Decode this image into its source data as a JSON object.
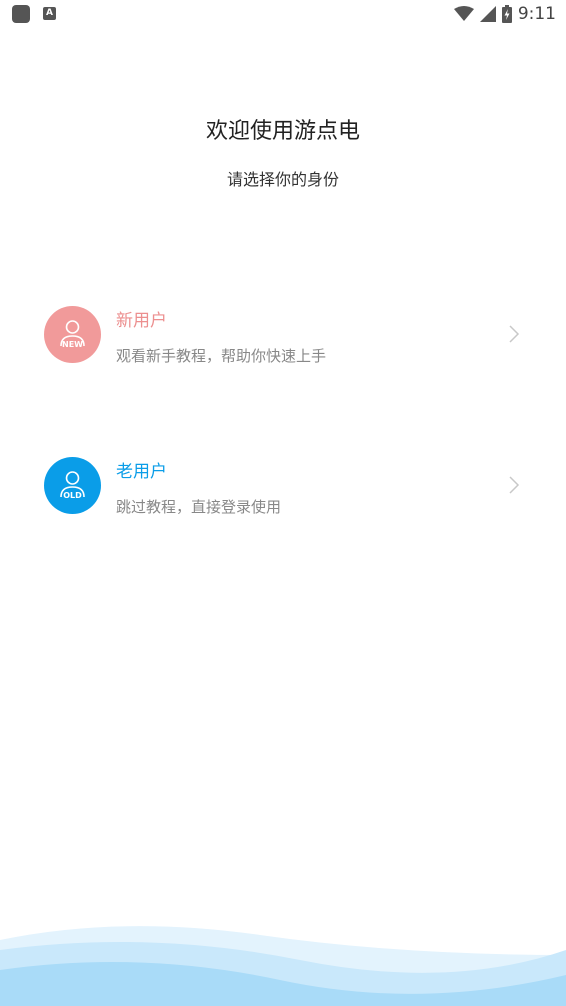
{
  "status_bar": {
    "time": "9:11",
    "icons": [
      "app-notification-icon",
      "a-notification-icon",
      "wifi-icon",
      "cell-signal-icon",
      "battery-charging-icon"
    ],
    "notification_letter": "A"
  },
  "header": {
    "title": "欢迎使用游点电",
    "subtitle": "请选择你的身份"
  },
  "options": [
    {
      "title": "新用户",
      "description": "观看新手教程，帮助你快速上手",
      "avatar_tag": "NEW",
      "accent_color": "#f19a9a",
      "icon": "user-new-icon"
    },
    {
      "title": "老用户",
      "description": "跳过教程，直接登录使用",
      "avatar_tag": "OLD",
      "accent_color": "#0a9de8",
      "icon": "user-old-icon"
    }
  ],
  "colors": {
    "background": "#ffffff",
    "wave_light": "#e3f3fd",
    "wave_mid": "#c9e8fb",
    "wave_dark": "#a9dbf8"
  }
}
